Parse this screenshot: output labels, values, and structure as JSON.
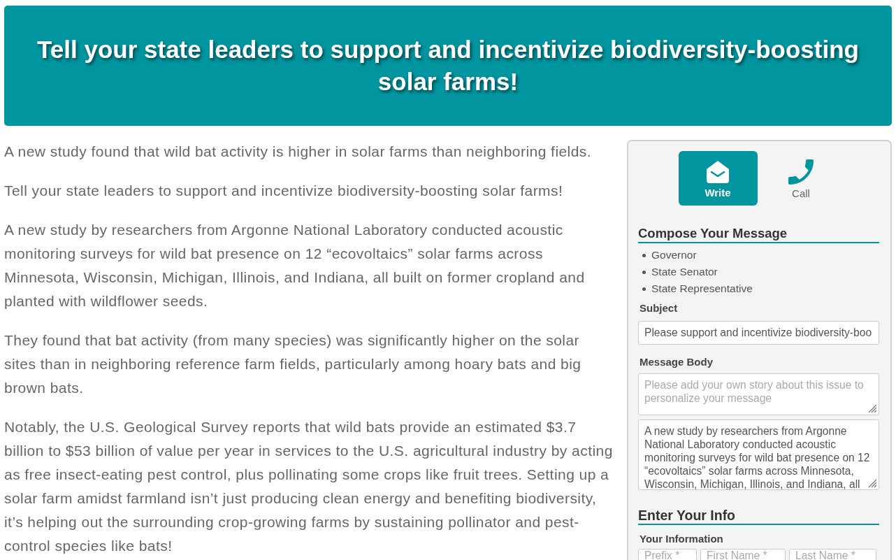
{
  "header": {
    "title": "Tell your state leaders to support and incentivize biodiversity-boosting solar farms!"
  },
  "article": {
    "paragraphs": [
      "A new study found that wild bat activity is higher in solar farms than neighboring fields.",
      "Tell your state leaders to support and incentivize biodiversity-boosting solar farms!",
      "A new study by researchers from Argonne National Laboratory conducted acoustic monitoring surveys for wild bat presence on 12 “ecovoltaics” solar farms across Minnesota, Wisconsin, Michigan, Illinois, and Indiana, all built on former cropland and planted with wildflower seeds.",
      "They found that bat activity (from many species) was significantly higher on the solar sites than in neighboring reference farm fields, particularly among hoary bats and big brown bats.",
      "Notably, the U.S. Geological Survey reports that wild bats provide an estimated $3.7 billion to $53 billion of value per year in services to the U.S. agricultural industry by acting as free insect-eating pest control, plus pollinating some crops like fruit trees. Setting up a solar farm amidst farmland isn’t just producing clean energy and benefiting biodiversity, it’s helping out the surrounding crop-growing farms by sustaining pollinator and pest-control species like bats!"
    ]
  },
  "action_panel": {
    "tabs": [
      {
        "kind": "write",
        "label": "Write",
        "selected": true
      },
      {
        "kind": "call",
        "label": "Call",
        "selected": false
      }
    ],
    "compose": {
      "heading": "Compose Your Message",
      "recipients": [
        "Governor",
        "State Senator",
        "State Representative"
      ],
      "subject": {
        "label": "Subject",
        "value": "Please support and incentivize biodiversity-boo"
      },
      "message_body": {
        "label": "Message Body",
        "placeholder": "Please add your own story about this issue to personalize your message",
        "value": "A new study by researchers from Argonne National Laboratory conducted acoustic monitoring surveys for wild bat presence on 12 “ecovoltaics” solar farms across Minnesota, Wisconsin, Michigan, Illinois, and Indiana, all"
      }
    },
    "info": {
      "heading": "Enter Your Info",
      "label": "Your Information",
      "fields": [
        {
          "placeholder": "Prefix *"
        },
        {
          "placeholder": "First Name *"
        },
        {
          "placeholder": "Last Name *"
        }
      ]
    }
  }
}
